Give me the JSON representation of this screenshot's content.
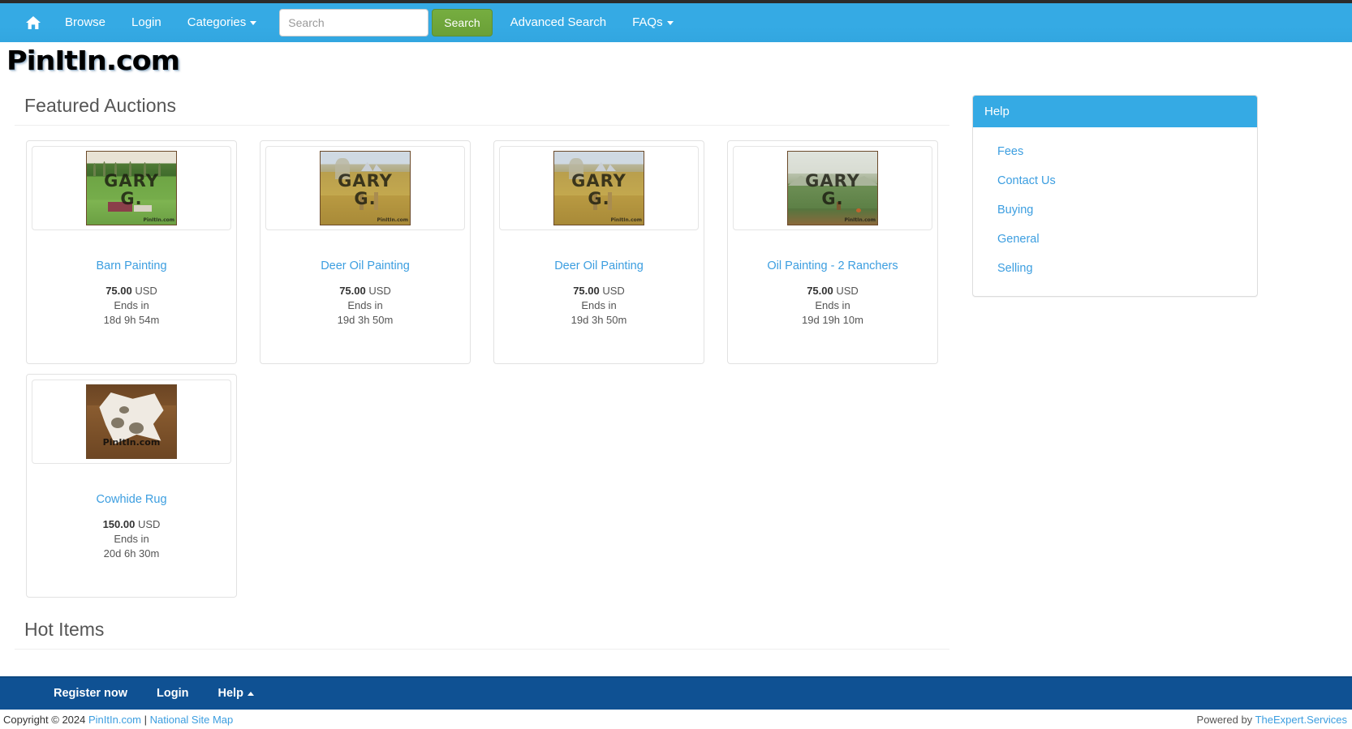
{
  "navbar": {
    "home_icon": "home-icon",
    "links": [
      {
        "label": "Browse",
        "caret": false
      },
      {
        "label": "Login",
        "caret": false
      },
      {
        "label": "Categories",
        "caret": true
      }
    ],
    "search": {
      "placeholder": "Search",
      "value": "",
      "button_label": "Search"
    },
    "right_links": [
      {
        "label": "Advanced Search",
        "caret": false
      },
      {
        "label": "FAQs",
        "caret": true
      }
    ],
    "bg_color": "#35aae4",
    "search_button_color": "#76ad40"
  },
  "logo": {
    "text": "PinItIn.com"
  },
  "main": {
    "featured_heading": "Featured Auctions",
    "hot_heading": "Hot Items",
    "auctions": [
      {
        "title": "Barn Painting",
        "price_amount": "75.00",
        "currency": "USD",
        "ends_label": "Ends in",
        "timer": "18d 9h 54m",
        "image_watermark_top": "GARY",
        "image_watermark_bottom": "G.",
        "image_watermark_site": "PinItIn.com",
        "scene": "barn"
      },
      {
        "title": "Deer Oil Painting",
        "price_amount": "75.00",
        "currency": "USD",
        "ends_label": "Ends in",
        "timer": "19d 3h 50m",
        "image_watermark_top": "GARY",
        "image_watermark_bottom": "G.",
        "image_watermark_site": "PinItIn.com",
        "scene": "deer"
      },
      {
        "title": "Deer Oil Painting",
        "price_amount": "75.00",
        "currency": "USD",
        "ends_label": "Ends in",
        "timer": "19d 3h 50m",
        "image_watermark_top": "GARY",
        "image_watermark_bottom": "G.",
        "image_watermark_site": "PinItIn.com",
        "scene": "deer"
      },
      {
        "title": "Oil Painting - 2 Ranchers",
        "price_amount": "75.00",
        "currency": "USD",
        "ends_label": "Ends in",
        "timer": "19d 19h 10m",
        "image_watermark_top": "GARY",
        "image_watermark_bottom": "G.",
        "image_watermark_site": "PinItIn.com",
        "scene": "ranchers"
      },
      {
        "title": "Cowhide Rug",
        "price_amount": "150.00",
        "currency": "USD",
        "ends_label": "Ends in",
        "timer": "20d 6h 30m",
        "image_watermark_top": "",
        "image_watermark_bottom": "",
        "image_watermark_site": "PinItIn.com",
        "scene": "rug"
      }
    ]
  },
  "sidebar": {
    "panel_title": "Help",
    "panel_header_color": "#35aae4",
    "links": [
      {
        "label": "Fees"
      },
      {
        "label": "Contact Us"
      },
      {
        "label": "Buying"
      },
      {
        "label": "General"
      },
      {
        "label": "Selling"
      }
    ]
  },
  "footer": {
    "bg_color": "#0f5193",
    "links": [
      {
        "label": "Register now",
        "caret": "none"
      },
      {
        "label": "Login",
        "caret": "none"
      },
      {
        "label": "Help",
        "caret": "up"
      }
    ],
    "copyright_prefix": "Copyright © 2024 ",
    "copyright_site": "PinItIn.com",
    "copyright_separator": " | ",
    "copyright_sitemap": "National Site Map",
    "powered_prefix": "Powered by ",
    "powered_link": "TheExpert.Services"
  }
}
